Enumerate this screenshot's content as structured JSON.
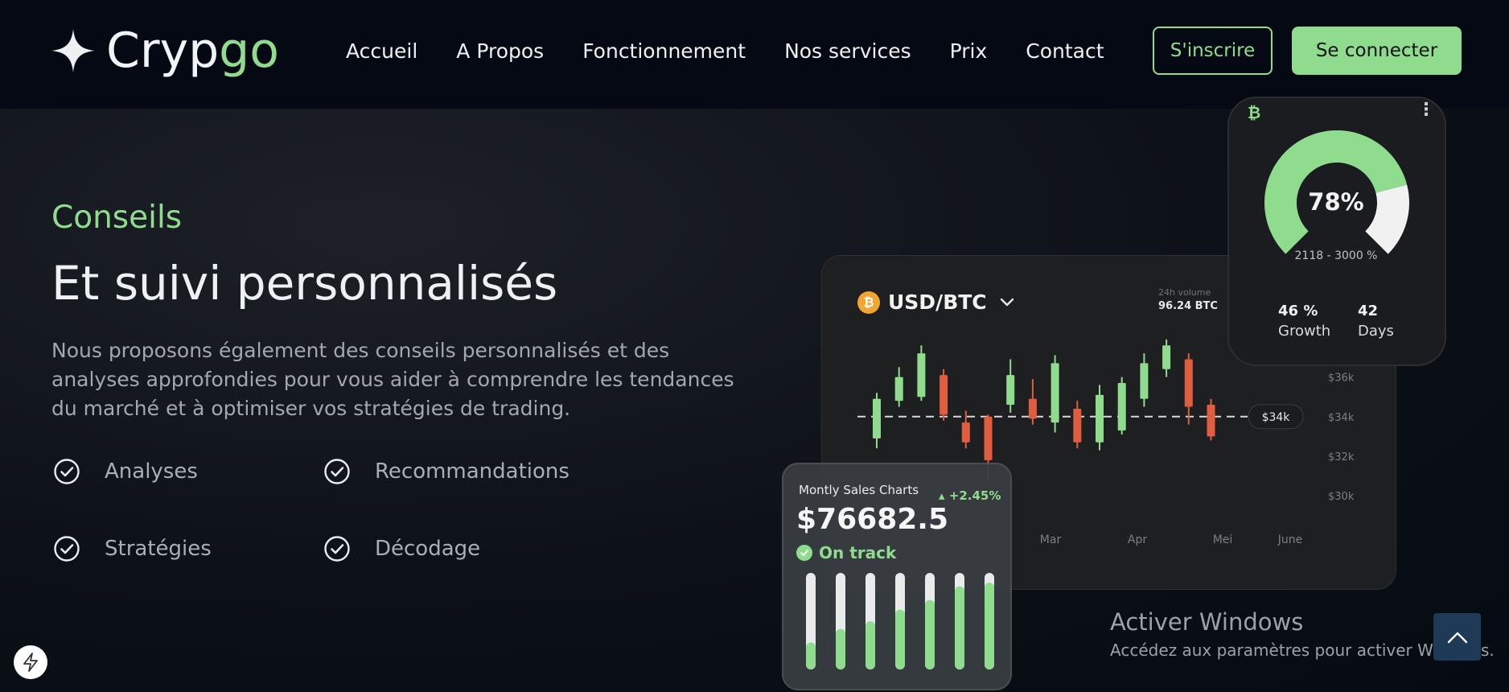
{
  "brand": {
    "name_part1": "Cryp",
    "name_part2": "go"
  },
  "nav": {
    "items": [
      {
        "label": "Accueil"
      },
      {
        "label": "A Propos"
      },
      {
        "label": "Fonctionnement"
      },
      {
        "label": "Nos services"
      },
      {
        "label": "Prix"
      },
      {
        "label": "Contact"
      }
    ],
    "signup_label": "S'inscrire",
    "login_label": "Se connecter"
  },
  "hero": {
    "eyebrow": "Conseils",
    "title": "Et suivi personnalisés",
    "description": "Nous proposons également des conseils personnalisés et des analyses approfondies pour vous aider à comprendre les tendances du marché et à optimiser vos stratégies de trading.",
    "features": [
      {
        "label": "Analyses"
      },
      {
        "label": "Recommandations"
      },
      {
        "label": "Stratégies"
      },
      {
        "label": "Décodage"
      }
    ]
  },
  "trading_card": {
    "pair": "USD/BTC",
    "coin_symbol": "₿",
    "volume_label": "24h volume",
    "volume_value": "96.24 BTC",
    "current_price_tag": "$34k",
    "y_ticks": [
      "$36k",
      "$34k",
      "$32k",
      "$30k"
    ],
    "x_ticks": [
      "Mar",
      "Apr",
      "Mei",
      "June"
    ],
    "candles": [
      {
        "open": 32.9,
        "close": 34.9,
        "high": 35.2,
        "low": 32.4
      },
      {
        "open": 34.8,
        "close": 36.0,
        "high": 36.5,
        "low": 34.5
      },
      {
        "open": 35.0,
        "close": 37.2,
        "high": 37.6,
        "low": 34.8
      },
      {
        "open": 36.1,
        "close": 34.1,
        "high": 36.4,
        "low": 33.8
      },
      {
        "open": 33.7,
        "close": 32.7,
        "high": 34.3,
        "low": 32.4
      },
      {
        "open": 34.0,
        "close": 31.8,
        "high": 34.1,
        "low": 30.8
      },
      {
        "open": 34.6,
        "close": 36.1,
        "high": 36.9,
        "low": 34.2
      },
      {
        "open": 34.9,
        "close": 33.9,
        "high": 35.9,
        "low": 33.6
      },
      {
        "open": 33.7,
        "close": 36.7,
        "high": 37.1,
        "low": 33.2
      },
      {
        "open": 34.4,
        "close": 32.7,
        "high": 34.8,
        "low": 32.4
      },
      {
        "open": 32.7,
        "close": 35.1,
        "high": 35.6,
        "low": 32.3
      },
      {
        "open": 33.3,
        "close": 35.7,
        "high": 36.0,
        "low": 33.1
      },
      {
        "open": 34.9,
        "close": 36.7,
        "high": 37.2,
        "low": 34.5
      },
      {
        "open": 36.4,
        "close": 37.6,
        "high": 37.9,
        "low": 36.0
      },
      {
        "open": 36.9,
        "close": 34.5,
        "high": 37.2,
        "low": 33.6
      },
      {
        "open": 34.6,
        "close": 33.0,
        "high": 34.9,
        "low": 32.8
      }
    ],
    "colors": {
      "up": "#8fdc8e",
      "down": "#e05e3f"
    }
  },
  "goal_card": {
    "percent_label": "78%",
    "percent_value": 0.78,
    "range": "2118 - 3000 %",
    "stat1_value": "46 %",
    "stat1_label": "Growth",
    "stat2_value": "42",
    "stat2_label": "Days",
    "coin_symbol": "₿",
    "menu_glyph": "⋮"
  },
  "sales_card": {
    "title": "Montly Sales Charts",
    "delta": "+2.45%",
    "amount": "$76682.5",
    "status": "On track",
    "bar_fill_levels": [
      0.28,
      0.42,
      0.5,
      0.62,
      0.72,
      0.86,
      0.9
    ]
  },
  "watermark": {
    "title": "Activer Windows",
    "subtitle": "Accédez aux paramètres pour activer Windows."
  },
  "theme": {
    "accent": "#8fdc8e",
    "background": "#0a0f16"
  }
}
